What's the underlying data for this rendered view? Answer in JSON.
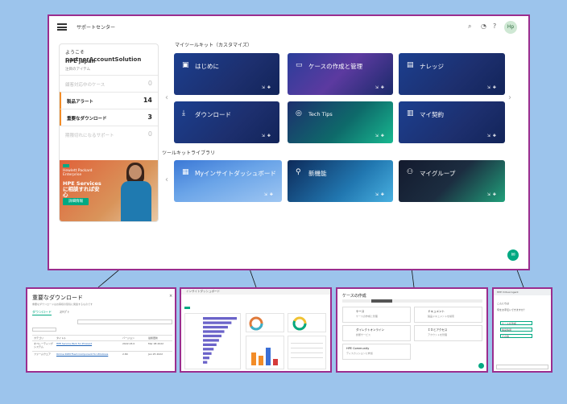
{
  "header": {
    "title": "サポートセンター",
    "avatar_initials": "Hp"
  },
  "sidebar": {
    "welcome_prefix": "ようこそ",
    "welcome_user": "partnerAccountSolution",
    "company": "HPE japan",
    "noticed": "注目のアイテム",
    "items": [
      {
        "label": "顧客対応中のケース",
        "count": "0",
        "state": "dim"
      },
      {
        "label": "製品アラート",
        "count": "14",
        "state": "active"
      },
      {
        "label": "重要なダウンロード",
        "count": "3",
        "state": "active"
      },
      {
        "label": "期限切れになるサポート",
        "count": "0",
        "state": "dim"
      }
    ],
    "promo": {
      "corp": "Hewlett Packard Enterprise",
      "headline": "HPE Servicesに相談すれば安心",
      "button": "詳細情報"
    }
  },
  "my_toolkit": {
    "label": "マイツールキット（カスタマイズ）",
    "tiles": [
      {
        "title": "はじめに",
        "icon": "clipboard-icon"
      },
      {
        "title": "ケースの作成と管理",
        "icon": "folder-icon"
      },
      {
        "title": "ナレッジ",
        "icon": "book-icon"
      },
      {
        "title": "ダウンロード",
        "icon": "download-icon"
      },
      {
        "title": "Tech Tips",
        "icon": "lightbulb-icon"
      },
      {
        "title": "マイ契約",
        "icon": "document-icon"
      }
    ]
  },
  "toolkit_library": {
    "label": "ツールキットライブラリ",
    "tiles": [
      {
        "title": "Myインサイトダッシュボード",
        "icon": "chart-icon"
      },
      {
        "title": "新機能",
        "icon": "new-icon"
      },
      {
        "title": "マイグループ",
        "icon": "group-icon"
      }
    ]
  },
  "thumb_downloads": {
    "title": "重要なダウンロード",
    "subtitle": "重要なダウンロードはお客様の環境に関連するものです",
    "tabs": [
      "ダウンロード",
      "ｽｸﾘﾌﾟﾄ"
    ],
    "col_headers": [
      "カテゴリ",
      "タイトル",
      "バージョン",
      "最終更新"
    ],
    "rows": [
      {
        "category": "オペレーティングシステム",
        "title": "HPE Service Pack for ProLiant",
        "version": "2022.03.0",
        "date": "Mar 08 2022"
      },
      {
        "category": "ファームウェア",
        "title": "Online ROM Flash Component for Windows",
        "version": "2.80",
        "date": "Jan 25 2022"
      }
    ]
  },
  "thumb_dashboard": {
    "title": "インサイトダッシュボード",
    "chart_data": {
      "type": "bar",
      "orientation": "horizontal",
      "categories": [
        "a",
        "b",
        "c",
        "d",
        "e",
        "f",
        "g",
        "h",
        "i",
        "j",
        "k"
      ],
      "values": [
        95,
        80,
        70,
        60,
        52,
        45,
        38,
        30,
        24,
        18,
        12
      ]
    }
  },
  "thumb_cases": {
    "title": "ケースの作成",
    "cards": [
      {
        "title": "ケース",
        "desc": "ケースの作成と管理"
      },
      {
        "title": "ドキュメント",
        "desc": "製品ドキュメントを検索"
      },
      {
        "title": "ダイレクトオンライン",
        "desc": "診断サービス"
      },
      {
        "title": "ＩＤとアクセス",
        "desc": "アカウントを管理"
      },
      {
        "title": "HPE Community",
        "desc": "ディスカッションに参加"
      }
    ]
  },
  "thumb_chat": {
    "title": "HPE Virtual Agent",
    "messages": [
      "こんにちは",
      "何をお手伝いできますか？",
      "ケースを作成",
      "製品情報",
      "その他"
    ]
  }
}
